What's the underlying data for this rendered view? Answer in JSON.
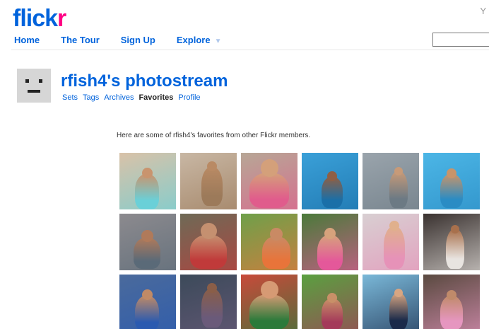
{
  "header": {
    "logo_main": "flick",
    "logo_accent": "r",
    "corner_glyph": "Y",
    "nav": [
      {
        "label": "Home",
        "has_menu": false
      },
      {
        "label": "The Tour",
        "has_menu": false
      },
      {
        "label": "Sign Up",
        "has_menu": false
      },
      {
        "label": "Explore",
        "has_menu": true
      }
    ],
    "search_value": ""
  },
  "profile": {
    "title": "rfish4's photostream",
    "tabs": [
      {
        "label": "Sets",
        "active": false
      },
      {
        "label": "Tags",
        "active": false
      },
      {
        "label": "Archives",
        "active": false
      },
      {
        "label": "Favorites",
        "active": true
      },
      {
        "label": "Profile",
        "active": false
      }
    ]
  },
  "favorites": {
    "intro": "Here are some of rfish4's favorites from other Flickr members.",
    "thumbnails": [
      {
        "bg": "#d9c2a8",
        "accent": "#6ad0d8",
        "skin": "#c9946e"
      },
      {
        "bg": "#c8b7a4",
        "accent": "#9c7a5a",
        "skin": "#b98a64"
      },
      {
        "bg": "#b7a796",
        "accent": "#e05c8c",
        "skin": "#d4a07a"
      },
      {
        "bg": "#3aa0d8",
        "accent": "#1a6fa8",
        "skin": "#8e5f45"
      },
      {
        "bg": "#9aa4ac",
        "accent": "#6c7a84",
        "skin": "#c79a78"
      },
      {
        "bg": "#4cb6e6",
        "accent": "#2a8cc4",
        "skin": "#c8946a"
      },
      {
        "bg": "#8c8a8e",
        "accent": "#5a6a78",
        "skin": "#b07a5a"
      },
      {
        "bg": "#6e6a56",
        "accent": "#c03a3a",
        "skin": "#c59070"
      },
      {
        "bg": "#6ea04a",
        "accent": "#e8743a",
        "skin": "#c98a64"
      },
      {
        "bg": "#4a7a3a",
        "accent": "#e4589a",
        "skin": "#d6a27c"
      },
      {
        "bg": "#d8cfd2",
        "accent": "#e692b8",
        "skin": "#e0b08c"
      },
      {
        "bg": "#3a3230",
        "accent": "#e8e4e0",
        "skin": "#a8704c"
      },
      {
        "bg": "#4a6a9c",
        "accent": "#2a5ab0",
        "skin": "#c08a66"
      },
      {
        "bg": "#3c4a5a",
        "accent": "#6a5a7a",
        "skin": "#8a5e48"
      },
      {
        "bg": "#c84a3a",
        "accent": "#2a7a3a",
        "skin": "#d69a74"
      },
      {
        "bg": "#5aa040",
        "accent": "#a43a5a",
        "skin": "#c89068"
      },
      {
        "bg": "#7ab8d8",
        "accent": "#1a2a4a",
        "skin": "#d8a682"
      },
      {
        "bg": "#5a4a40",
        "accent": "#e696c0",
        "skin": "#c08a6a"
      }
    ]
  }
}
